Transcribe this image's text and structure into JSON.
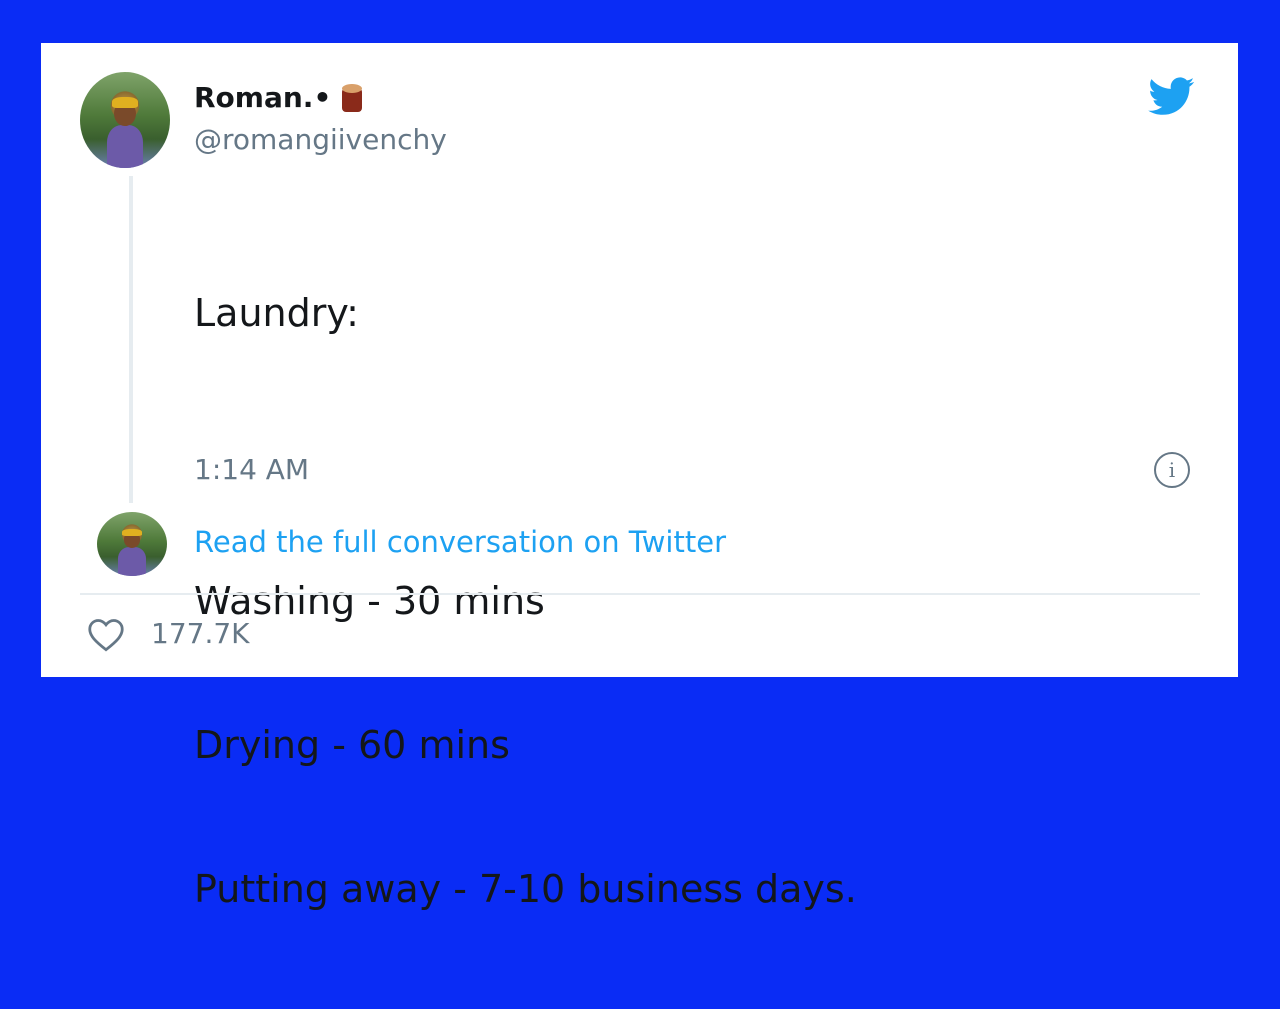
{
  "tweet": {
    "author_name": "Roman.•",
    "author_handle": "@romangiivenchy",
    "lines": [
      "Laundry:",
      "",
      "Washing - 30 mins",
      "Drying - 60 mins",
      "Putting away - 7-10 business days."
    ],
    "timestamp": "1:14 AM",
    "read_full_link": "Read the full conversation on Twitter",
    "likes_count": "177.7K",
    "info_icon_glyph": "i"
  },
  "icons": {
    "brand": "twitter-bird-icon",
    "name_emoji": "log-icon",
    "info": "info-icon",
    "like": "heart-icon"
  },
  "colors": {
    "background": "#0a2cf5",
    "card": "#ffffff",
    "link": "#1da1f2",
    "secondary_text": "#657786",
    "primary_text": "#14171a"
  }
}
